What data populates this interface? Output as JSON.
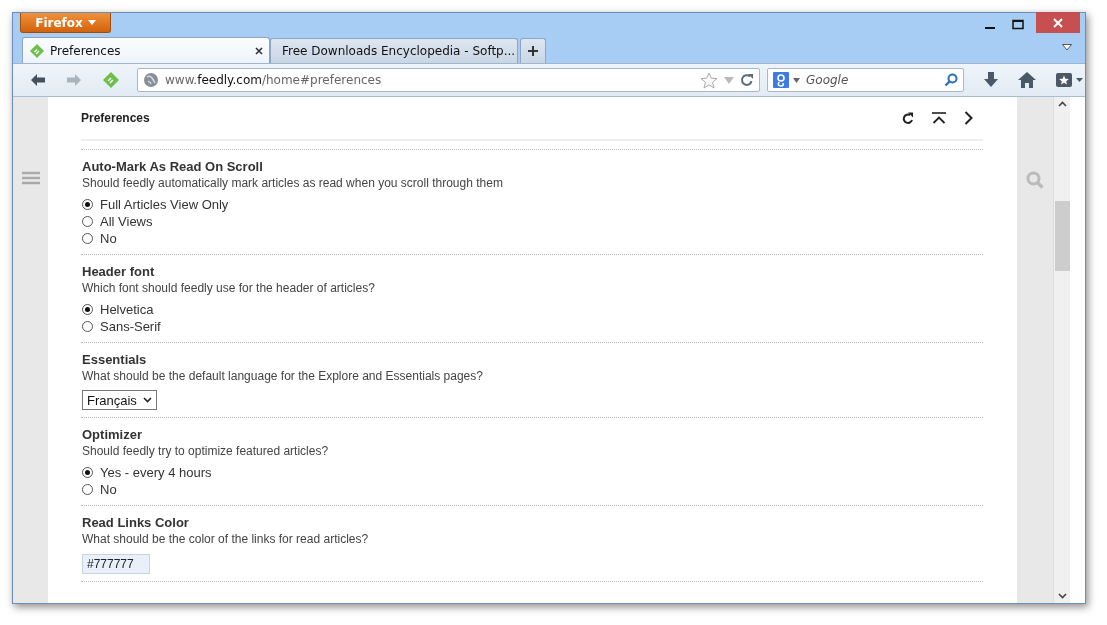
{
  "firefox_button": {
    "label": "Firefox"
  },
  "tabs": [
    {
      "title": "Preferences",
      "selected": true
    },
    {
      "title": "Free Downloads Encyclopedia - Softp...",
      "selected": false
    }
  ],
  "url": {
    "prefix": "www.",
    "domain": "feedly.com",
    "path": "/home#preferences"
  },
  "search": {
    "placeholder": "Google"
  },
  "page": {
    "title": "Preferences",
    "sections": [
      {
        "kind": "radio",
        "title": "Auto-Mark As Read On Scroll",
        "description": "Should feedly automatically mark articles as read when you scroll through them",
        "options": [
          {
            "label": "Full Articles View Only",
            "selected": true
          },
          {
            "label": "All Views",
            "selected": false
          },
          {
            "label": "No",
            "selected": false
          }
        ]
      },
      {
        "kind": "radio",
        "title": "Header font",
        "description": "Which font should feedly use for the header of articles?",
        "options": [
          {
            "label": "Helvetica",
            "selected": true
          },
          {
            "label": "Sans-Serif",
            "selected": false
          }
        ]
      },
      {
        "kind": "select",
        "title": "Essentials",
        "description": "What should be the default language for the Explore and Essentials pages?",
        "value": "Français"
      },
      {
        "kind": "radio",
        "title": "Optimizer",
        "description": "Should feedly try to optimize featured articles?",
        "options": [
          {
            "label": "Yes - every 4 hours",
            "selected": true
          },
          {
            "label": "No",
            "selected": false
          }
        ]
      },
      {
        "kind": "text",
        "title": "Read Links Color",
        "description": "What should be the color of the links for read articles?",
        "value": "#777777"
      }
    ]
  }
}
